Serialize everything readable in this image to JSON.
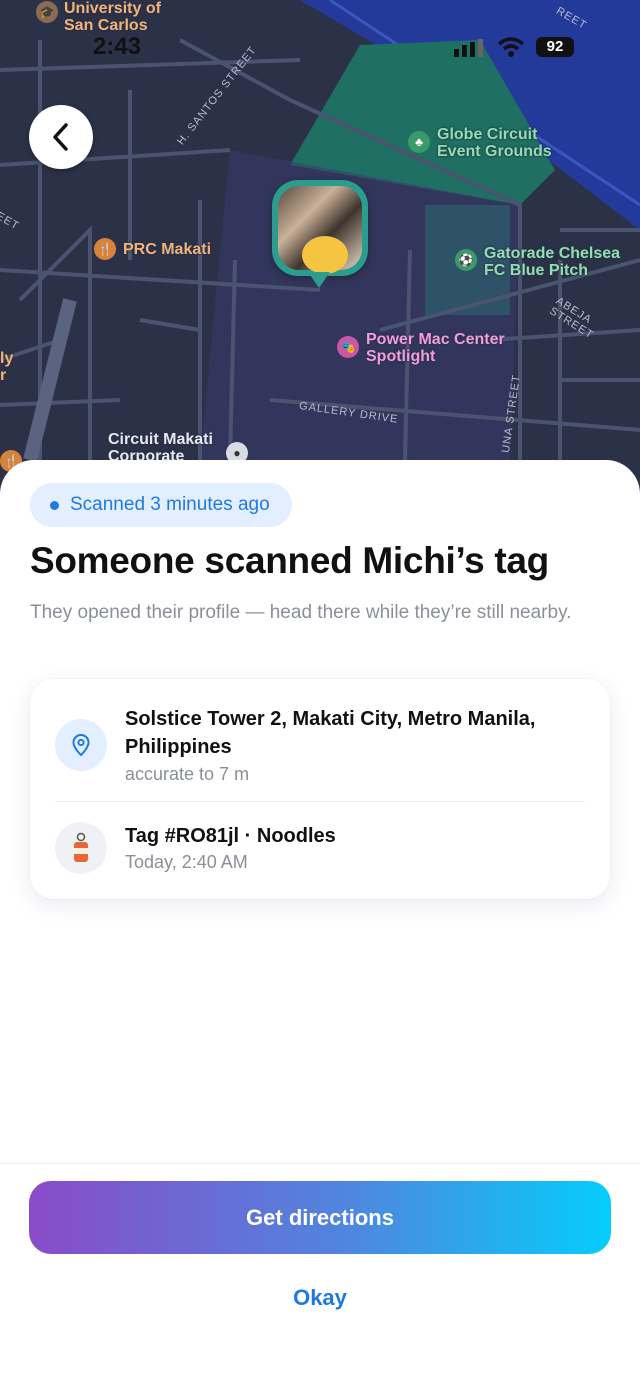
{
  "status_bar": {
    "time": "2:43",
    "battery": "92"
  },
  "map": {
    "labels": {
      "university": "University of San Carlos",
      "globe": "Globe Circuit Event Grounds",
      "prc": "PRC Makati",
      "gatorade": "Gatorade Chelsea FC Blue Pitch",
      "powermac": "Power Mac Center Spotlight",
      "circuit": "Circuit Makati Corporate",
      "partial_left": "ly r"
    },
    "streets": {
      "h_santos": "H. SANTOS STREET",
      "abeja": "ABEJA STREET",
      "gallery": "GALLERY DRIVE",
      "una": "UNA STREET",
      "eet": "EET",
      "reet": "REET"
    }
  },
  "sheet": {
    "badge": "Scanned 3 minutes ago",
    "title": "Someone scanned Michi’s tag",
    "subtitle": "They opened their profile — head there while they’re still nearby.",
    "location": {
      "title": "Solstice Tower 2, Makati City, Metro Manila, Philippines",
      "accuracy": "accurate to 7 m"
    },
    "tag": {
      "title": "Tag #RO81jl · Noodles",
      "time": "Today, 2:40 AM"
    },
    "primary_button": "Get directions",
    "secondary_button": "Okay"
  },
  "colors": {
    "accent": "#1f7ae0",
    "map_bg": "#2b3247",
    "marker": "#2a9d8f",
    "gradient_start": "#8a4bc9",
    "gradient_end": "#05cdfc"
  }
}
